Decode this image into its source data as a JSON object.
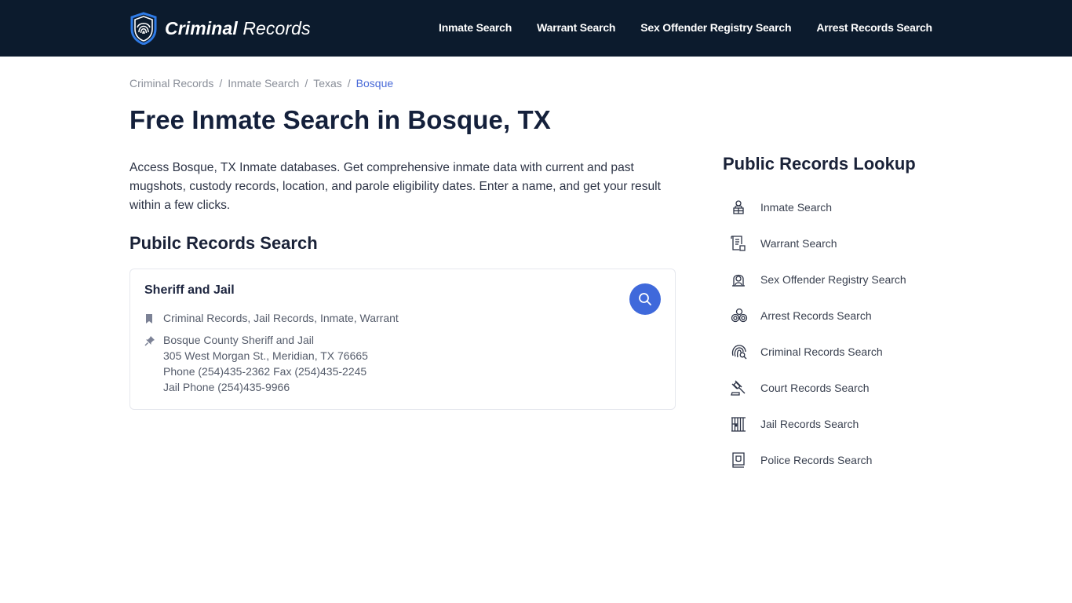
{
  "header": {
    "logo": {
      "bold": "Criminal",
      "regular": "Records"
    },
    "nav": [
      {
        "label": "Inmate Search"
      },
      {
        "label": "Warrant Search"
      },
      {
        "label": "Sex Offender Registry Search"
      },
      {
        "label": "Arrest Records Search"
      }
    ]
  },
  "breadcrumb": [
    {
      "label": "Criminal Records"
    },
    {
      "label": "Inmate Search"
    },
    {
      "label": "Texas"
    },
    {
      "label": "Bosque",
      "current": true
    }
  ],
  "breadcrumb_separator": "/",
  "page_title": "Free Inmate Search in Bosque, TX",
  "intro": "Access Bosque, TX Inmate databases. Get comprehensive inmate data with current and past mugshots, custody records, location, and parole eligibility dates. Enter a name, and get your result within a few clicks.",
  "section_title": "Pubilc Records Search",
  "card": {
    "title": "Sheriff and Jail",
    "tags_icon": "bookmark-icon",
    "tags": "Criminal Records, Jail Records, Inmate, Warrant",
    "address_icon": "pin-icon",
    "address_lines": [
      "Bosque County Sheriff and Jail",
      "305 West Morgan St., Meridian, TX 76665",
      "Phone (254)435-2362 Fax (254)435-2245",
      "Jail Phone (254)435-9966"
    ],
    "search_icon": "search-icon",
    "accent": "#3f69db"
  },
  "sidebar": {
    "title": "Public Records Lookup",
    "items": [
      {
        "label": "Inmate Search",
        "icon": "inmate-icon"
      },
      {
        "label": "Warrant Search",
        "icon": "warrant-document-icon"
      },
      {
        "label": "Sex Offender Registry Search",
        "icon": "offender-icon"
      },
      {
        "label": "Arrest Records Search",
        "icon": "handcuffs-icon"
      },
      {
        "label": "Criminal Records Search",
        "icon": "fingerprint-search-icon"
      },
      {
        "label": "Court Records Search",
        "icon": "gavel-icon"
      },
      {
        "label": "Jail Records Search",
        "icon": "jail-bars-icon"
      },
      {
        "label": "Police Records Search",
        "icon": "police-badge-icon"
      }
    ]
  },
  "colors": {
    "header_bg": "#0c1b2d",
    "link_active": "#4a6bd8",
    "heading": "#14203b"
  }
}
